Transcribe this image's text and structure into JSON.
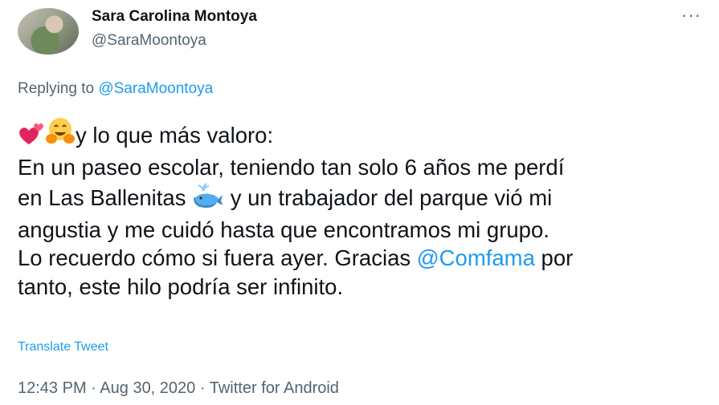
{
  "author": {
    "name": "Sara Carolina Montoya",
    "handle": "@SaraMoontoya"
  },
  "header": {
    "more_icon": "more-horizontal-icon",
    "more_glyph": "···"
  },
  "reply": {
    "prefix": "Replying to",
    "to": "@SaraMoontoya"
  },
  "tweet": {
    "line1": "y lo que más valoro:",
    "line2": "En un paseo escolar, teniendo tan solo 6 años me perdí",
    "line3_a": "en Las Ballenitas",
    "line3_b": "y un trabajador del parque vió mi",
    "line4": "angustia y me cuidó hasta que encontramos mi grupo.",
    "line5_a": "Lo recuerdo cómo si fuera ayer. Gracias",
    "mention": "@Comfama",
    "line5_b": "por",
    "line6": "tanto, este hilo podría ser infinito.",
    "emojis": [
      "two-hearts-emoji",
      "hugging-face-emoji",
      "spouting-whale-emoji"
    ]
  },
  "translate_label": "Translate Tweet",
  "meta": {
    "time": "12:43 PM",
    "date": "Aug 30, 2020",
    "source": "Twitter for Android",
    "separator": "·"
  },
  "colors": {
    "accent": "#1d9bf0",
    "muted": "#536471",
    "text": "#0f1419"
  }
}
